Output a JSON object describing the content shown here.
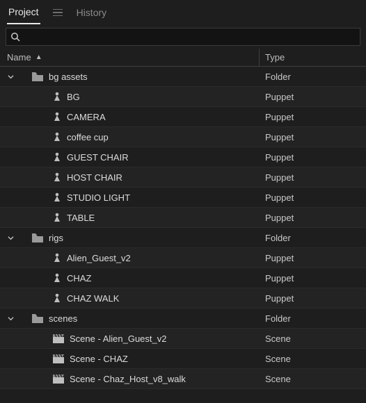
{
  "tabs": {
    "project": "Project",
    "history": "History"
  },
  "search": {
    "placeholder": ""
  },
  "columns": {
    "name": "Name",
    "type": "Type"
  },
  "typeLabels": {
    "folder": "Folder",
    "puppet": "Puppet",
    "scene": "Scene"
  },
  "items": {
    "bgAssets": {
      "label": "bg assets"
    },
    "bg": {
      "label": "BG"
    },
    "camera": {
      "label": "CAMERA"
    },
    "coffee": {
      "label": "coffee cup"
    },
    "guestChair": {
      "label": "GUEST CHAIR"
    },
    "hostChair": {
      "label": "HOST CHAIR"
    },
    "studioLight": {
      "label": "STUDIO LIGHT"
    },
    "table": {
      "label": "TABLE"
    },
    "rigs": {
      "label": "rigs"
    },
    "alien": {
      "label": "Alien_Guest_v2"
    },
    "chaz": {
      "label": "CHAZ"
    },
    "chazWalk": {
      "label": "CHAZ WALK"
    },
    "scenes": {
      "label": "scenes"
    },
    "sceneAlien": {
      "label": "Scene - Alien_Guest_v2"
    },
    "sceneChaz": {
      "label": "Scene - CHAZ"
    },
    "sceneChazWalk": {
      "label": "Scene - Chaz_Host_v8_walk"
    }
  }
}
